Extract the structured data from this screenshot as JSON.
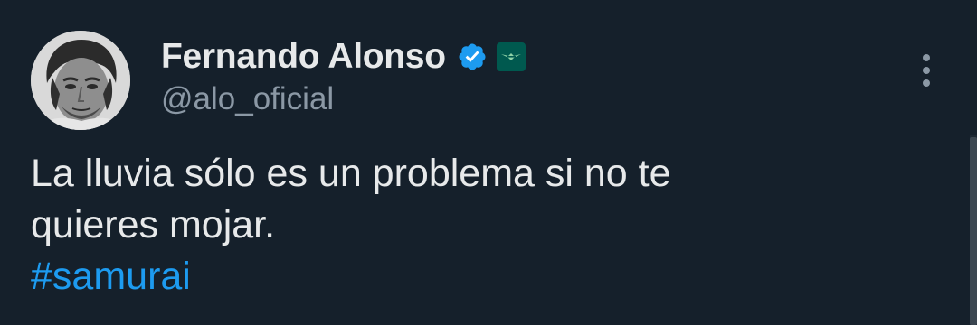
{
  "author": {
    "display_name": "Fernando Alonso",
    "handle": "@alo_oficial",
    "avatar_icon": "profile-photo",
    "verified_icon": "verified-badge-icon",
    "affiliate_icon": "aston-martin-badge-icon"
  },
  "tweet": {
    "line1": "La lluvia sólo es un problema si no te",
    "line2": "quieres mojar.",
    "hashtag": "#samurai"
  },
  "menu": {
    "more_icon": "more-vertical-icon"
  },
  "colors": {
    "background": "#15202b",
    "primary_text": "#e7e9ea",
    "secondary_text": "#8b98a5",
    "link": "#1d9bf0",
    "verified": "#1d9bf0",
    "affiliate_badge": "#00594f"
  }
}
